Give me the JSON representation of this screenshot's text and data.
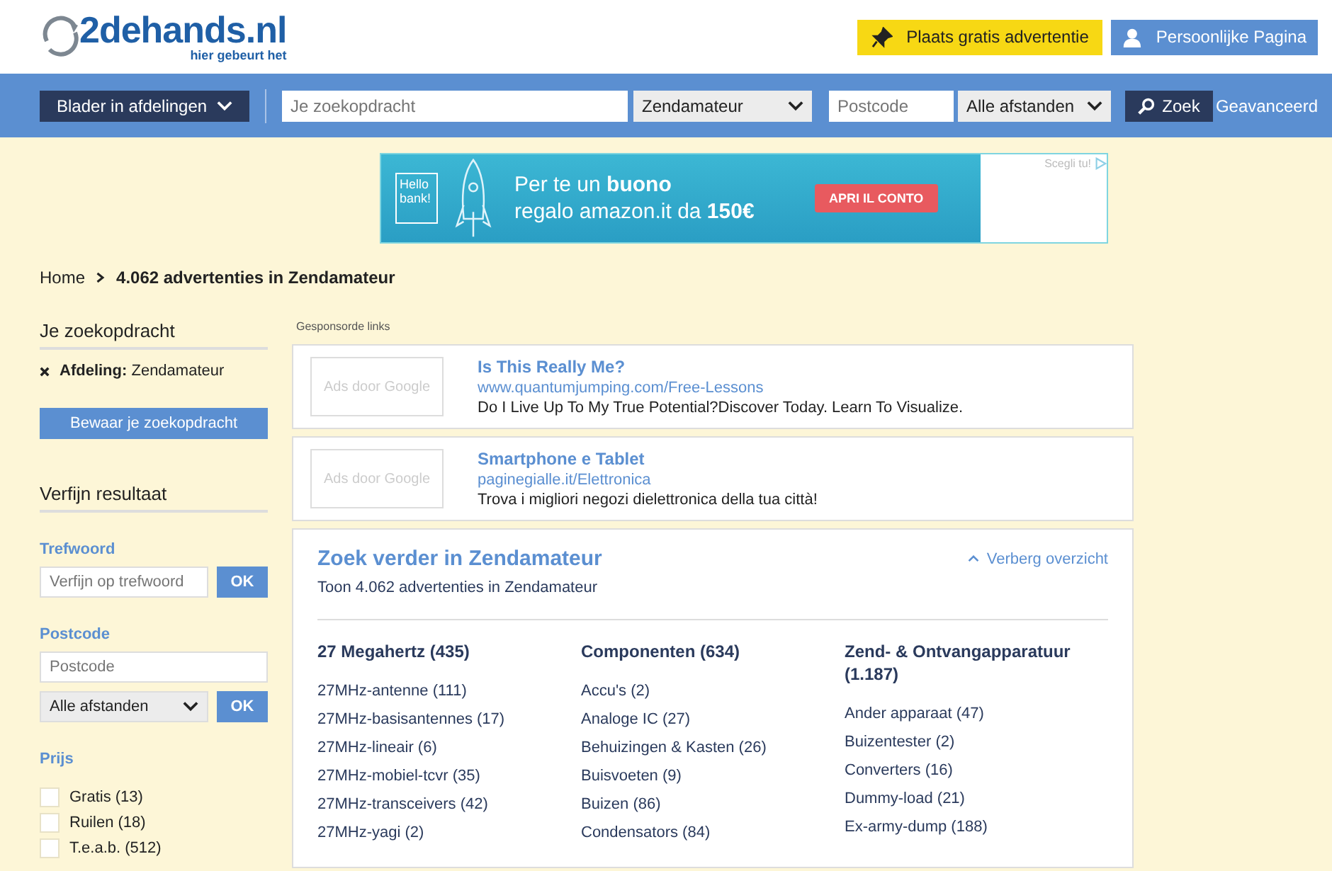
{
  "header": {
    "logo": "2dehands.nl",
    "tagline": "hier gebeurt het",
    "post_button": "Plaats gratis advertentie",
    "account_button": "Persoonlijke Pagina"
  },
  "searchbar": {
    "browse": "Blader in afdelingen",
    "query_placeholder": "Je zoekopdracht",
    "category": "Zendamateur",
    "postcode_placeholder": "Postcode",
    "distance": "Alle afstanden",
    "search_button": "Zoek",
    "advanced": "Geavanceerd"
  },
  "banner": {
    "brand": "Hello bank!",
    "line_1": "Per te un **buono**",
    "line_2": "regalo amazon.it da **150€**",
    "cta": "APRI IL CONTO",
    "choice": "Scegli tu!"
  },
  "breadcrumb": {
    "home": "Home",
    "current": "4.062 advertenties in Zendamateur"
  },
  "sidebar": {
    "search_title": "Je zoekopdracht",
    "filter": "**Afdeling:** Zendamateur",
    "save_button": "Bewaar je zoekopdracht",
    "refine_title": "Verfijn resultaat",
    "keyword_label": "Trefwoord",
    "keyword_placeholder": "Verfijn op trefwoord",
    "ok_1": "OK",
    "postcode_label": "Postcode",
    "postcode_placeholder": "Postcode",
    "distance": "Alle afstanden",
    "ok_2": "OK",
    "price_label": "Prijs",
    "price_options": [
      {
        "label": "Gratis (13)",
        "checked": false
      },
      {
        "label": "Ruilen (18)",
        "checked": false
      },
      {
        "label": "T.e.a.b. (512)",
        "checked": false
      }
    ]
  },
  "sponsored": {
    "title": "Gesponsorde links",
    "ads": [
      {
        "placeholder": "Ads door Google",
        "title": "Is This Really Me?",
        "url": "www.quantumjumping.com/Free-Lessons",
        "text": "Do I Live Up To My True Potential?Discover Today. Learn To Visualize."
      },
      {
        "placeholder": "Ads door Google",
        "title": "Smartphone e Tablet",
        "url": "paginegialle.it/Elettronica",
        "text": "Trova i migliori negozi dielettronica della tua città!"
      }
    ]
  },
  "overview": {
    "title": "Zoek verder in Zendamateur",
    "hide_link": "Verberg overzicht",
    "subtitle": "Toon 4.062 advertenties in Zendamateur",
    "columns": [
      {
        "heading": "27 Megahertz (435)",
        "items": [
          "27MHz-antenne (111)",
          "27MHz-basisantennes (17)",
          "27MHz-lineair (6)",
          "27MHz-mobiel-tcvr (35)",
          "27MHz-transceivers (42)",
          "27MHz-yagi (2)"
        ]
      },
      {
        "heading": "Componenten (634)",
        "items": [
          "Accu's (2)",
          "Analoge IC (27)",
          "Behuizingen & Kasten (26)",
          "Buisvoeten (9)",
          "Buizen (86)",
          "Condensators (84)"
        ]
      },
      {
        "heading": "Zend- & Ontvangapparatuur (1.187)",
        "items": [
          "Ander apparaat (47)",
          "Buizentester (2)",
          "Converters (16)",
          "Dummy-load (21)",
          "Ex-army-dump (188)"
        ]
      }
    ]
  }
}
